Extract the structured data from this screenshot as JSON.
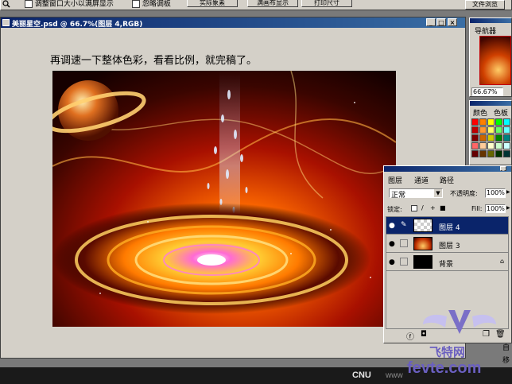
{
  "optionsbar": {
    "resize_windows_label": "调整窗口大小以满屏显示",
    "ignore_palettes_label": "忽略调板",
    "actual_pixels_label": "实际象素",
    "fit_on_screen_label": "满画布显示",
    "print_size_label": "打印尺寸",
    "file_browser_label": "文件浏览"
  },
  "document": {
    "title": "美丽星空.psd @ 66.7%(图层 4,RGB)",
    "caption": "再调速一下整体色彩，看看比例，就完稿了。"
  },
  "navigator": {
    "tab_label": "导航器",
    "zoom": "66.67%"
  },
  "color_panel": {
    "tab_color": "颜色",
    "tab_swatches": "色板",
    "swatches": [
      "#ff0000",
      "#ff8000",
      "#ffff00",
      "#00ff00",
      "#00ffff",
      "#0080ff",
      "#ff00ff",
      "#ff80c0",
      "#ffffff",
      "#c00000",
      "#ff9933",
      "#ffff66",
      "#66ff66",
      "#66ffff",
      "#6699ff",
      "#cc66ff",
      "#ff99cc",
      "#c0c0c0",
      "#800000",
      "#cc6600",
      "#cccc00",
      "#008000",
      "#008080",
      "#000080",
      "#800080",
      "#cc3366",
      "#808080",
      "#ff6666",
      "#ffcc99",
      "#ffffcc",
      "#ccffcc",
      "#ccffff",
      "#99ccff",
      "#cc99ff",
      "#ffccee",
      "#404040",
      "#660000",
      "#663300",
      "#666600",
      "#003300",
      "#003333",
      "#000033",
      "#330033",
      "#330011",
      "#000000"
    ]
  },
  "layers": {
    "tab_layers": "图层",
    "tab_channels": "通道",
    "tab_paths": "路径",
    "blend_mode": "正常",
    "opacity_label": "不透明度:",
    "opacity_value": "100%",
    "lock_label": "锁定:",
    "fill_label": "Fill:",
    "fill_value": "100%",
    "items": [
      {
        "name": "图层 4"
      },
      {
        "name": "图层 3"
      },
      {
        "name": "背景"
      }
    ]
  },
  "right_edge": {
    "auto_label": "自",
    "move_label": "移"
  },
  "watermark": {
    "cnu": "CNU",
    "www": "www",
    "brand_cn": "飞特网",
    "brand_en": "fevte.com"
  }
}
